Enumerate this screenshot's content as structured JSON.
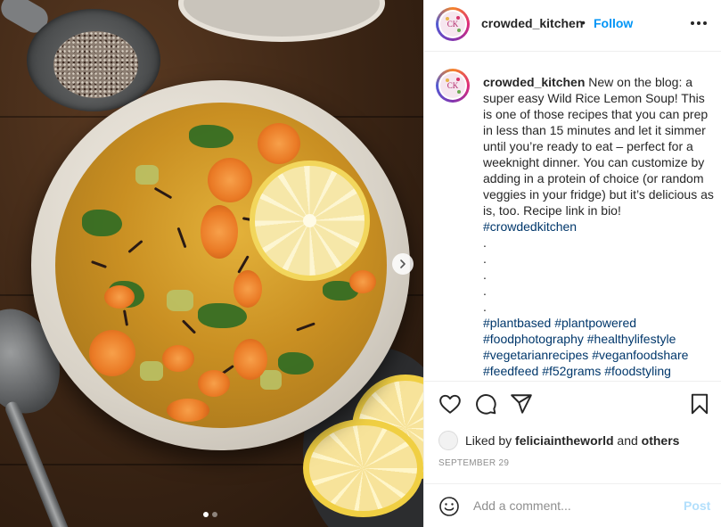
{
  "header": {
    "username": "crowded_kitchen",
    "separator": "•",
    "follow_label": "Follow"
  },
  "avatar": {
    "monogram": "CK"
  },
  "caption": {
    "username": "crowded_kitchen",
    "text": "New on the blog: a super easy Wild Rice Lemon Soup! This is one of those recipes that you can prep in less than 15 minutes and let it simmer until you’re ready to eat – perfect for a weeknight dinner. You can customize by adding in a protein of choice (or random veggies in your fridge) but it’s delicious as is, too. Recipe link in bio!",
    "hashtag_main": "#crowdedkitchen",
    "dots": [
      ".",
      ".",
      ".",
      ".",
      "."
    ],
    "hashtags": {
      "line1": [
        "#plantbased",
        "#plantpowered"
      ],
      "line2": [
        "#foodphotography",
        "#healthylifestyle"
      ],
      "line3": [
        "#vegetarianrecipes",
        "#veganfoodshare"
      ],
      "line4": [
        "#feedfeed",
        "#f52grams",
        "#foodstyling"
      ]
    }
  },
  "likes": {
    "prefix": "Liked by",
    "user": "feliciaintheworld",
    "middle": "and",
    "others": "others"
  },
  "date": "SEPTEMBER 29",
  "comment": {
    "placeholder": "Add a comment...",
    "post_label": "Post"
  },
  "carousel": {
    "current": 1,
    "total": 2
  },
  "icons": {
    "like": "heart-icon",
    "comment": "comment-icon",
    "share": "share-icon",
    "save": "bookmark-icon",
    "more": "more-icon",
    "emoji": "emoji-icon",
    "next": "chevron-right-icon"
  },
  "colors": {
    "link": "#0095f6",
    "hashtag": "#00376b",
    "muted": "#8e8e8e",
    "post_disabled": "#b2dffc"
  }
}
